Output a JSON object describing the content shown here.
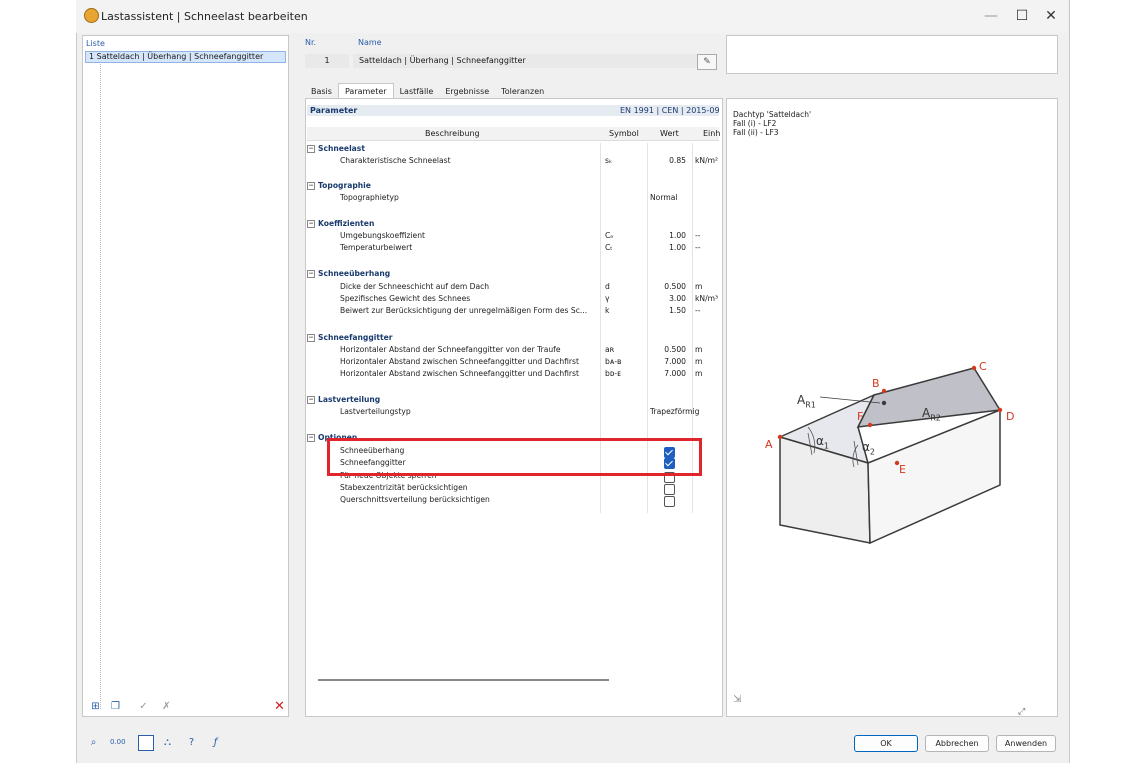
{
  "window": {
    "title": "Lastassistent | Schneelast bearbeiten",
    "minimize": "—",
    "maximize": "☐",
    "close": "✕"
  },
  "list": {
    "header": "Liste",
    "items": [
      {
        "label": "1  Satteldach | Überhang | Schneefanggitter"
      }
    ]
  },
  "header": {
    "nr_label": "Nr.",
    "name_label": "Name",
    "nr_value": "1",
    "name_value": "Satteldach | Überhang | Schneefanggitter"
  },
  "tabs": [
    "Basis",
    "Parameter",
    "Lastfälle",
    "Ergebnisse",
    "Toleranzen"
  ],
  "active_tab": "Parameter",
  "params": {
    "title": "Parameter",
    "norm": "EN 1991 | CEN | 2015-09",
    "columns": {
      "description": "Beschreibung",
      "symbol": "Symbol",
      "value": "Wert",
      "unit": "Einh"
    },
    "groups": [
      {
        "name": "Schneelast",
        "rows": [
          {
            "desc": "Charakteristische Schneelast",
            "symbol": "sₖ",
            "value": "0.85",
            "unit": "kN/m²"
          }
        ]
      },
      {
        "name": "Topographie",
        "rows": [
          {
            "desc": "Topographietyp",
            "symbol": "",
            "value": "Normal",
            "unit": ""
          }
        ]
      },
      {
        "name": "Koeffizienten",
        "rows": [
          {
            "desc": "Umgebungskoeffizient",
            "symbol": "Cₑ",
            "value": "1.00",
            "unit": "--"
          },
          {
            "desc": "Temperaturbeiwert",
            "symbol": "Cₜ",
            "value": "1.00",
            "unit": "--"
          }
        ]
      },
      {
        "name": "Schneeüberhang",
        "rows": [
          {
            "desc": "Dicke der Schneeschicht auf dem Dach",
            "symbol": "d",
            "value": "0.500",
            "unit": "m"
          },
          {
            "desc": "Spezifisches Gewicht des Schnees",
            "symbol": "γ",
            "value": "3.00",
            "unit": "kN/m³"
          },
          {
            "desc": "Beiwert zur Berücksichtigung der unregelmäßigen Form des Sc...",
            "symbol": "k",
            "value": "1.50",
            "unit": "--"
          }
        ]
      },
      {
        "name": "Schneefanggitter",
        "rows": [
          {
            "desc": "Horizontaler Abstand der Schneefanggitter von der Traufe",
            "symbol": "aʀ",
            "value": "0.500",
            "unit": "m"
          },
          {
            "desc": "Horizontaler Abstand zwischen Schneefanggitter und Dachfirst",
            "symbol": "bᴀ-ʙ",
            "value": "7.000",
            "unit": "m"
          },
          {
            "desc": "Horizontaler Abstand zwischen Schneefanggitter und Dachfirst",
            "symbol": "bᴅ-ᴇ",
            "value": "7.000",
            "unit": "m"
          }
        ]
      },
      {
        "name": "Lastverteilung",
        "rows": [
          {
            "desc": "Lastverteilungstyp",
            "symbol": "",
            "value": "Trapezförmig",
            "unit": ""
          }
        ]
      },
      {
        "name": "Optionen",
        "rows": []
      }
    ],
    "options": [
      {
        "label": "Schneeüberhang",
        "checked": true
      },
      {
        "label": "Schneefanggitter",
        "checked": true
      },
      {
        "label": "Für neue Objekte sperren",
        "checked": false
      },
      {
        "label": "Stabexzentrizität berücksichtigen",
        "checked": false
      },
      {
        "label": "Querschnittsverteilung berücksichtigen",
        "checked": false
      }
    ]
  },
  "info": {
    "line1": "Dachtyp 'Satteldach'",
    "line2": "Fall (i) - LF2",
    "line3": "Fall (ii) - LF3"
  },
  "diagram": {
    "A": "A",
    "B": "B",
    "C": "C",
    "D": "D",
    "E": "E",
    "F": "F",
    "AR1": "A",
    "AR1_sub": "R1",
    "AR2": "A",
    "AR2_sub": "R2",
    "alpha1": "α",
    "alpha1_sub": "1",
    "alpha2": "α",
    "alpha2_sub": "2"
  },
  "buttons": {
    "ok": "OK",
    "cancel": "Abbrechen",
    "apply": "Anwenden"
  },
  "colors": {
    "highlight": "#e0262b",
    "accent": "#0067c0",
    "label_red": "#d23a1e"
  }
}
